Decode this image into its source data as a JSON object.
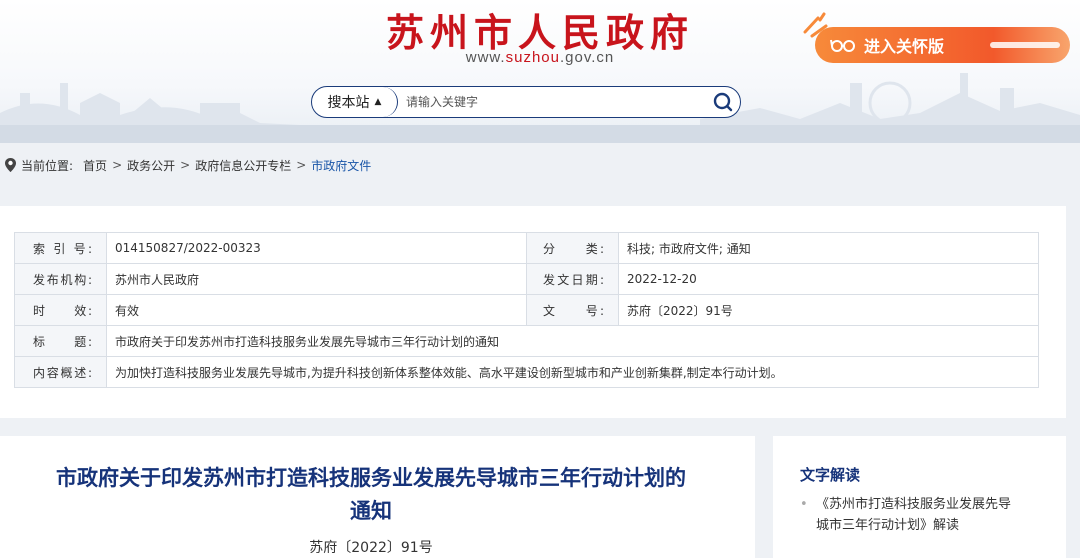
{
  "header": {
    "site_title": "苏州市人民政府",
    "site_url_prefix": "www.",
    "site_url_highlight": "suzhou",
    "site_url_suffix": ".gov.cn",
    "care_button_label": "进入关怀版"
  },
  "search": {
    "scope_label": "搜本站",
    "placeholder": "请输入关键字"
  },
  "breadcrumb": {
    "prefix": "当前位置:",
    "items": [
      "首页",
      "政务公开",
      "政府信息公开专栏",
      "市政府文件"
    ],
    "separator": ">"
  },
  "info": {
    "index_label": "索 引 号:",
    "index_value": "014150827/2022-00323",
    "category_label": "分　　类:",
    "category_value": "科技; 市政府文件; 通知",
    "publisher_label": "发布机构:",
    "publisher_value": "苏州市人民政府",
    "date_label": "发文日期:",
    "date_value": "2022-12-20",
    "validity_label": "时　　效:",
    "validity_value": "有效",
    "docno_label": "文　　号:",
    "docno_value": "苏府〔2022〕91号",
    "title_label": "标　　题:",
    "title_value": "市政府关于印发苏州市打造科技服务业发展先导城市三年行动计划的通知",
    "summary_label": "内容概述:",
    "summary_value": "为加快打造科技服务业发展先导城市,为提升科技创新体系整体效能、高水平建设创新型城市和产业创新集群,制定本行动计划。"
  },
  "article": {
    "title_line1": "市政府关于印发苏州市打造科技服务业发展先导城市三年行动计划的",
    "title_line2": "通知",
    "doc_number": "苏府〔2022〕91号"
  },
  "sidebar": {
    "title": "文字解读",
    "item_line1": "《苏州市打造科技服务业发展先导",
    "item_line2": "城市三年行动计划》解读",
    "bullet": "•"
  },
  "colors": {
    "brand_red": "#c8141c",
    "navy": "#16337a",
    "link_blue": "#1a56a8",
    "care_orange": "#f2592b"
  },
  "icons": [
    "location-pin-icon",
    "search-icon",
    "glasses-icon",
    "caret-up-icon"
  ]
}
